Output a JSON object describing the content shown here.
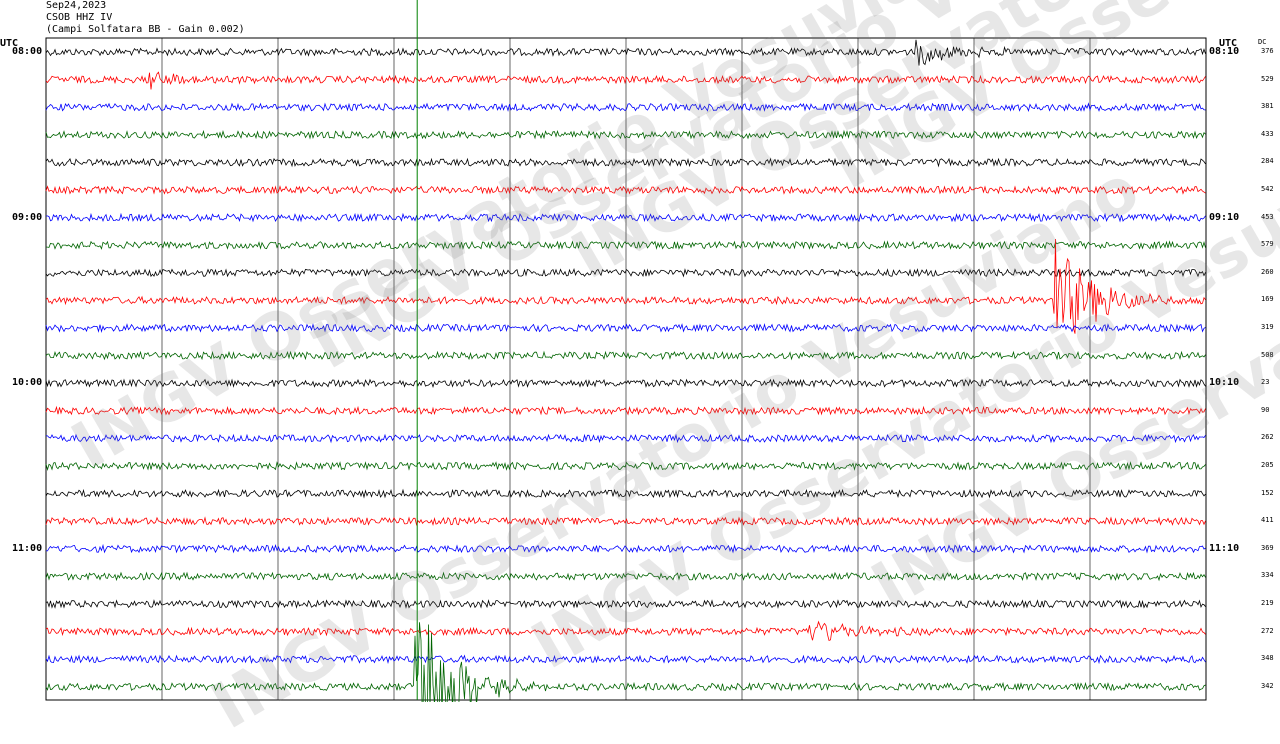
{
  "header": {
    "date": "Sep24,2023",
    "station": "CSOB HHZ IV",
    "location": "(Campi Solfatara BB - Gain 0.002)"
  },
  "left_axis_label": "UTC",
  "right_axis_label": "UTC",
  "dc_label": "DC",
  "left_hour_labels": [
    "08:00",
    "09:00",
    "10:00",
    "11:00"
  ],
  "right_hour_labels": [
    "08:10",
    "09:10",
    "10:10",
    "11:10"
  ],
  "dc_values": [
    "376",
    "529",
    "381",
    "433",
    "284",
    "542",
    "453",
    "579",
    "260",
    "169",
    "319",
    "508",
    "23",
    "90",
    "262",
    "205",
    "152",
    "411",
    "369",
    "334",
    "219",
    "272",
    "348",
    "342"
  ],
  "watermark": "INGV Osservatorio Vesuviano",
  "colors": {
    "trace_cycle": [
      "#000000",
      "#ff0000",
      "#0000ff",
      "#006400"
    ],
    "marker": "#008000",
    "grid": "#000000"
  },
  "chart_data": {
    "type": "line",
    "title": "CSOB HHZ IV (Campi Solfatara BB - Gain 0.002)",
    "date": "Sep24,2023",
    "rows_per_hour": 6,
    "minutes_per_row": 10,
    "row_start_times": [
      "08:00",
      "08:10",
      "08:20",
      "08:30",
      "08:40",
      "08:50",
      "09:00",
      "09:10",
      "09:20",
      "09:30",
      "09:40",
      "09:50",
      "10:00",
      "10:10",
      "10:20",
      "10:30",
      "10:40",
      "10:50",
      "11:00",
      "11:10",
      "11:20",
      "11:30",
      "11:40",
      "11:50"
    ],
    "vertical_grid_divisions": 10,
    "events": [
      {
        "row": 0,
        "minute": 7.5,
        "amplitude": "medium",
        "color": "black"
      },
      {
        "row": 1,
        "minute": 0.9,
        "amplitude": "small",
        "color": "red"
      },
      {
        "row": 9,
        "minute": 8.7,
        "amplitude": "large",
        "color": "red"
      },
      {
        "row": 21,
        "minute": 6.6,
        "amplitude": "medium",
        "color": "green"
      },
      {
        "row": 23,
        "minute": 3.2,
        "amplitude": "very large",
        "color": "green"
      }
    ],
    "marker_minute": 3.2
  }
}
